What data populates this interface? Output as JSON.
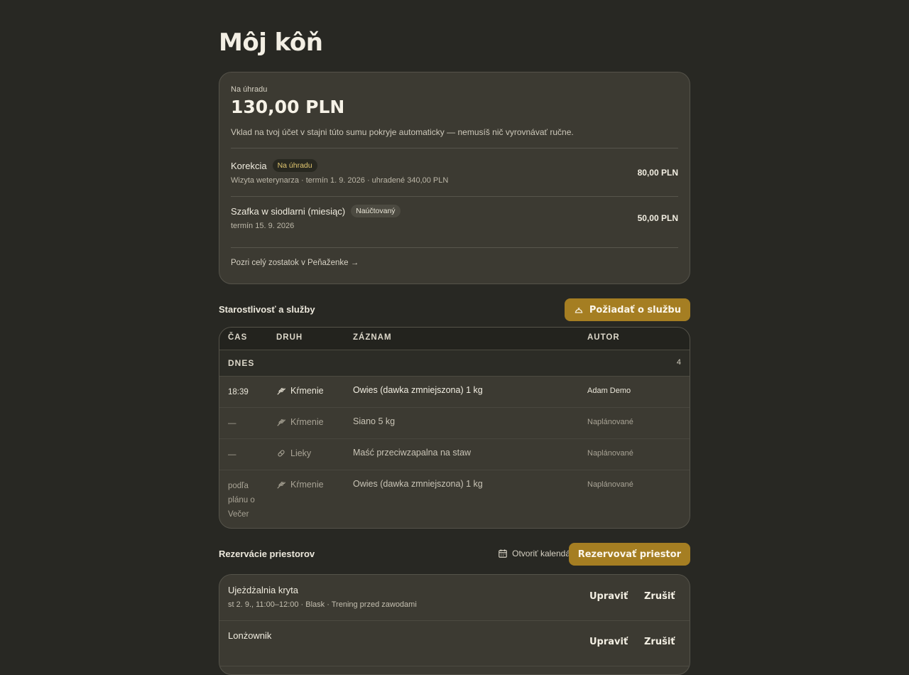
{
  "page": {
    "title": "Môj kôň"
  },
  "payment": {
    "label": "Na úhradu",
    "amount": "130,00 PLN",
    "description": "Vklad na tvoj účet v stajni túto sumu pokryje automaticky — nemusíš nič vyrovnávať ručne.",
    "items": [
      {
        "name": "Korekcia",
        "badge": "Na úhradu",
        "sub": "Wizyta weterynarza · termín 1. 9. 2026 · uhradené 340,00 PLN",
        "amount": "80,00 PLN"
      },
      {
        "name": "Szafka w siodlarni (miesiąc)",
        "badge": "Naúčtovaný",
        "sub": "termín 15. 9. 2026",
        "amount": "50,00 PLN"
      }
    ],
    "wallet_link": "Pozri celý zostatok v Peňaženke →"
  },
  "services": {
    "title": "Starostlivosť a služby",
    "request_button": "Požiadať o službu",
    "columns": {
      "time": "ČAS",
      "kind": "DRUH",
      "record": "ZÁZNAM",
      "author": "AUTOR"
    },
    "group": {
      "label": "DNES",
      "count": "4"
    },
    "rows": [
      {
        "time": "18:39",
        "kind": "Kŕmenie",
        "icon": "wheat-icon",
        "record": "Owies (dawka zmniejszona) 1 kg",
        "author": "Adam Demo"
      },
      {
        "time": "—",
        "kind": "Kŕmenie",
        "icon": "wheat-icon",
        "record": "Siano 5 kg",
        "author": "Naplánované"
      },
      {
        "time": "—",
        "kind": "Lieky",
        "icon": "pill-icon",
        "record": "Maść przeciwzapalna na staw",
        "author": "Naplánované"
      },
      {
        "time": "podľa plánu o Večer",
        "kind": "Kŕmenie",
        "icon": "wheat-icon",
        "record": "Owies (dawka zmniejszona) 1 kg",
        "author": "Naplánované"
      }
    ]
  },
  "reservations": {
    "title": "Rezervácie priestorov",
    "calendar_link": "Otvoriť kalendár",
    "reserve_button": "Rezervovať priestor",
    "items": [
      {
        "name": "Ujeżdżalnia kryta",
        "sub": "st 2. 9., 11:00–12:00 · Blask · Trening przed zawodami",
        "edit": "Upraviť",
        "cancel": "Zrušiť"
      },
      {
        "name": "Lonżownik",
        "sub": "",
        "edit": "Upraviť",
        "cancel": "Zrušiť"
      }
    ]
  },
  "colors": {
    "background": "#282823",
    "card": "#3c3a32",
    "accent": "#a57e22"
  }
}
